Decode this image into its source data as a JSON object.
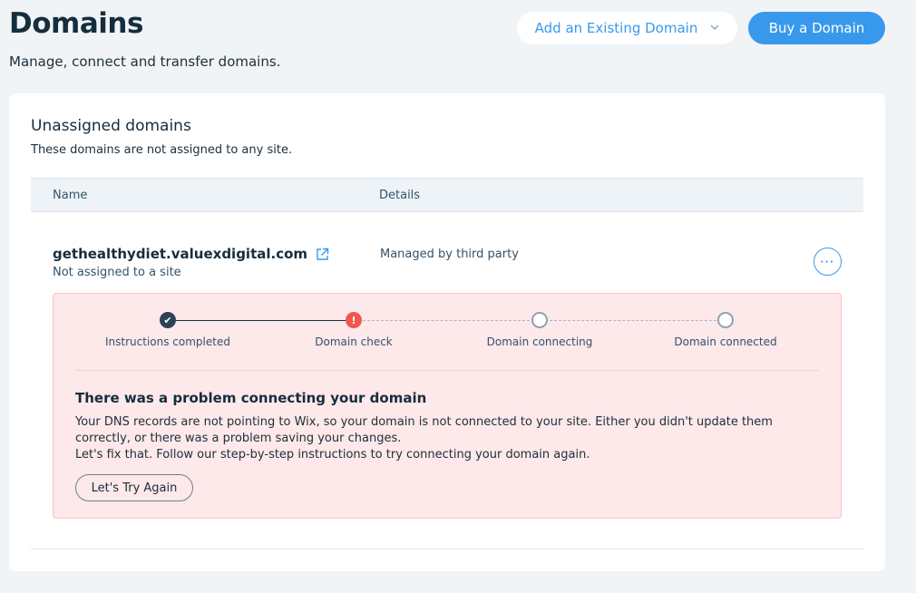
{
  "header": {
    "title": "Domains",
    "subtitle": "Manage, connect and transfer domains.",
    "add_existing_label": "Add an Existing Domain",
    "buy_label": "Buy a Domain"
  },
  "section": {
    "title": "Unassigned domains",
    "description": "These domains are not assigned to any site."
  },
  "table": {
    "columns": [
      "Name",
      "Details"
    ]
  },
  "domain": {
    "name": "gethealthydiet.valuexdigital.com",
    "status": "Not assigned to a site",
    "details": "Managed by third party",
    "more_label": "···"
  },
  "progress": {
    "steps": [
      {
        "label": "Instructions completed",
        "state": "done",
        "glyph": "✔"
      },
      {
        "label": "Domain check",
        "state": "error",
        "glyph": "!"
      },
      {
        "label": "Domain connecting",
        "state": "pending",
        "glyph": ""
      },
      {
        "label": "Domain connected",
        "state": "pending",
        "glyph": ""
      }
    ]
  },
  "problem": {
    "title": "There was a problem connecting your domain",
    "line1": "Your DNS records are not pointing to Wix, so your domain is not connected to your site. Either you didn't update them correctly, or there was a problem saving your changes.",
    "line2": "Let's fix that. Follow our step-by-step instructions to try connecting your domain again.",
    "retry_label": "Let's Try Again"
  },
  "colors": {
    "accent": "#3899ec",
    "error": "#ee5951",
    "error_bg": "#fde8ea",
    "text": "#162d3d",
    "page_bg": "#f0f4f7"
  }
}
